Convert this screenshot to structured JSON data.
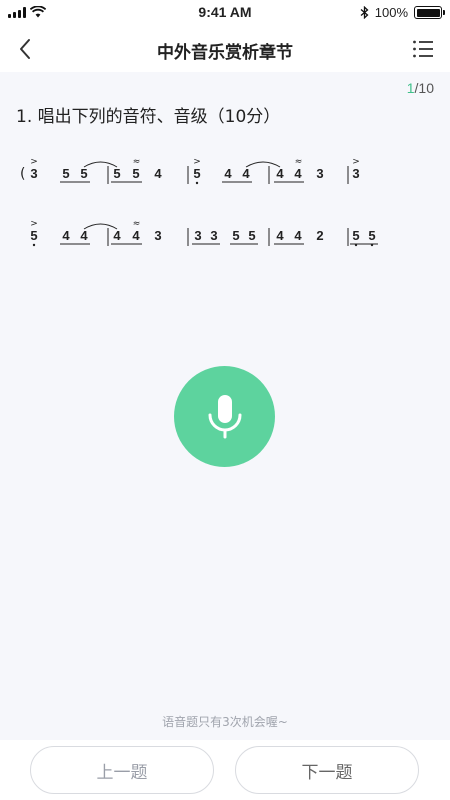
{
  "status": {
    "time": "9:41 AM",
    "battery": "100%",
    "battery_level": 1.0
  },
  "nav": {
    "title": "中外音乐赏析章节"
  },
  "quiz": {
    "current": "1",
    "separator": "/",
    "total": "10",
    "question": "1. 唱出下列的音符、音级（10分）"
  },
  "score": {
    "line1": [
      "3",
      "5",
      "5",
      "5",
      "5",
      "4",
      "5",
      "4",
      "4",
      "4",
      "4",
      "3",
      "3"
    ],
    "line2": [
      "5",
      "4",
      "4",
      "4",
      "4",
      "3",
      "3",
      "3",
      "5",
      "5",
      "4",
      "4",
      "2",
      "5",
      "5"
    ]
  },
  "hint": "语音题只有3次机会喔~",
  "buttons": {
    "prev": "上一题",
    "next": "下一题"
  },
  "colors": {
    "accent": "#5dd39e",
    "progress": "#3fc08a",
    "background": "#f6f7fb"
  }
}
